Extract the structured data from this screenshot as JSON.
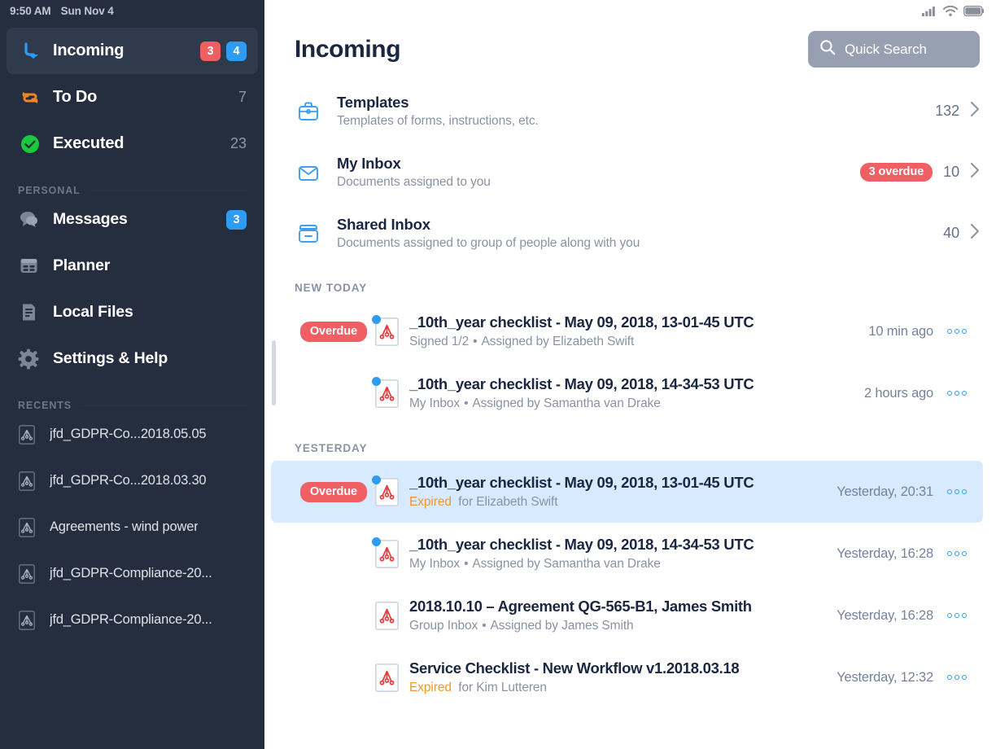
{
  "statusbar": {
    "time": "9:50 AM",
    "date": "Sun Nov 4",
    "icons": [
      "cellular-signal-icon",
      "wifi-icon",
      "battery-icon"
    ]
  },
  "sidebar": {
    "primary_items": [
      {
        "label": "Incoming",
        "icon": "incoming-arrow-icon",
        "badge_red": "3",
        "badge_blue": "4",
        "active": true
      },
      {
        "label": "To Do",
        "icon": "repeat-arrows-icon",
        "count": "7",
        "active": false
      },
      {
        "label": "Executed",
        "icon": "check-circle-icon",
        "count": "23",
        "active": false
      }
    ],
    "personal_section": {
      "label": "PERSONAL",
      "items": [
        {
          "label": "Messages",
          "icon": "chat-bubble-icon",
          "badge_blue": "3"
        },
        {
          "label": "Planner",
          "icon": "calendar-icon"
        },
        {
          "label": "Local Files",
          "icon": "document-icon"
        },
        {
          "label": "Settings & Help",
          "icon": "gear-icon"
        }
      ]
    },
    "recents_section": {
      "label": "RECENTS",
      "items": [
        {
          "label": "jfd_GDPR-Co...2018.05.05",
          "icon": "pdf-icon"
        },
        {
          "label": "jfd_GDPR-Co...2018.03.30",
          "icon": "pdf-icon"
        },
        {
          "label": "Agreements - wind power",
          "icon": "pdf-icon"
        },
        {
          "label": "jfd_GDPR-Compliance-20...",
          "icon": "pdf-icon"
        },
        {
          "label": "jfd_GDPR-Compliance-20...",
          "icon": "pdf-icon"
        }
      ]
    }
  },
  "main": {
    "title": "Incoming",
    "search": {
      "placeholder": "Quick Search",
      "icon": "search-icon"
    },
    "folders": [
      {
        "icon": "briefcase-icon",
        "title": "Templates",
        "subtitle": "Templates of forms, instructions, etc.",
        "count": "132"
      },
      {
        "icon": "inbox-open-icon",
        "title": "My Inbox",
        "subtitle": "Documents assigned to you",
        "overdue": "3 overdue",
        "count": "10"
      },
      {
        "icon": "inbox-drawer-icon",
        "title": "Shared Inbox",
        "subtitle": "Documents assigned to group of people along with you",
        "count": "40"
      }
    ],
    "groups": [
      {
        "label": "NEW TODAY",
        "documents": [
          {
            "tag": "Overdue",
            "unread": true,
            "icon": "pdf-icon",
            "title": "_10th_year checklist - May 09, 2018, 13-01-45 UTC",
            "sub_left": "Signed 1/2",
            "sub_left_state": "normal",
            "sub_right": "Assigned by Elizabeth Swift",
            "time": "10 min ago",
            "selected": false
          },
          {
            "tag": "",
            "unread": true,
            "icon": "pdf-icon",
            "title": "_10th_year checklist - May 09, 2018, 14-34-53 UTC",
            "sub_left": "My Inbox",
            "sub_left_state": "normal",
            "sub_right": "Assigned by Samantha van Drake",
            "time": "2 hours ago",
            "selected": false
          }
        ]
      },
      {
        "label": "YESTERDAY",
        "documents": [
          {
            "tag": "Overdue",
            "unread": true,
            "icon": "pdf-icon",
            "title": "_10th_year checklist - May 09, 2018, 13-01-45 UTC",
            "sub_left": "Expired",
            "sub_left_state": "expired",
            "sub_right": "for Elizabeth Swift",
            "sub_no_sep": true,
            "time": "Yesterday, 20:31",
            "selected": true
          },
          {
            "tag": "",
            "unread": true,
            "icon": "pdf-icon",
            "title": "_10th_year checklist - May 09, 2018, 14-34-53 UTC",
            "sub_left": "My Inbox",
            "sub_left_state": "normal",
            "sub_right": "Assigned by Samantha van Drake",
            "time": "Yesterday, 16:28",
            "selected": false
          },
          {
            "tag": "",
            "unread": false,
            "icon": "pdf-icon",
            "title": "2018.10.10 – Agreement QG-565-B1, James Smith",
            "sub_left": "Group Inbox",
            "sub_left_state": "normal",
            "sub_right": "Assigned by James Smith",
            "time": "Yesterday, 16:28",
            "selected": false
          },
          {
            "tag": "",
            "unread": false,
            "icon": "pdf-icon",
            "title": "Service Checklist - New Workflow v1.2018.03.18",
            "sub_left": "Expired",
            "sub_left_state": "expired",
            "sub_right": "for Kim Lutteren",
            "sub_no_sep": true,
            "time": "Yesterday, 12:32",
            "selected": false
          }
        ]
      }
    ],
    "row_menu_icon": "more-options-icon"
  },
  "colors": {
    "sidebar_bg": "#242e3e",
    "sidebar_active": "#2f3b4d",
    "accent_blue": "#2f9cf4",
    "accent_red": "#ef5f63",
    "accent_orange": "#f2962f",
    "accent_green": "#19ca3c",
    "selected_row": "#d7eaff",
    "search_bg": "#97a0b0",
    "title_text": "#1b2741",
    "muted_text": "#8a93a3"
  }
}
